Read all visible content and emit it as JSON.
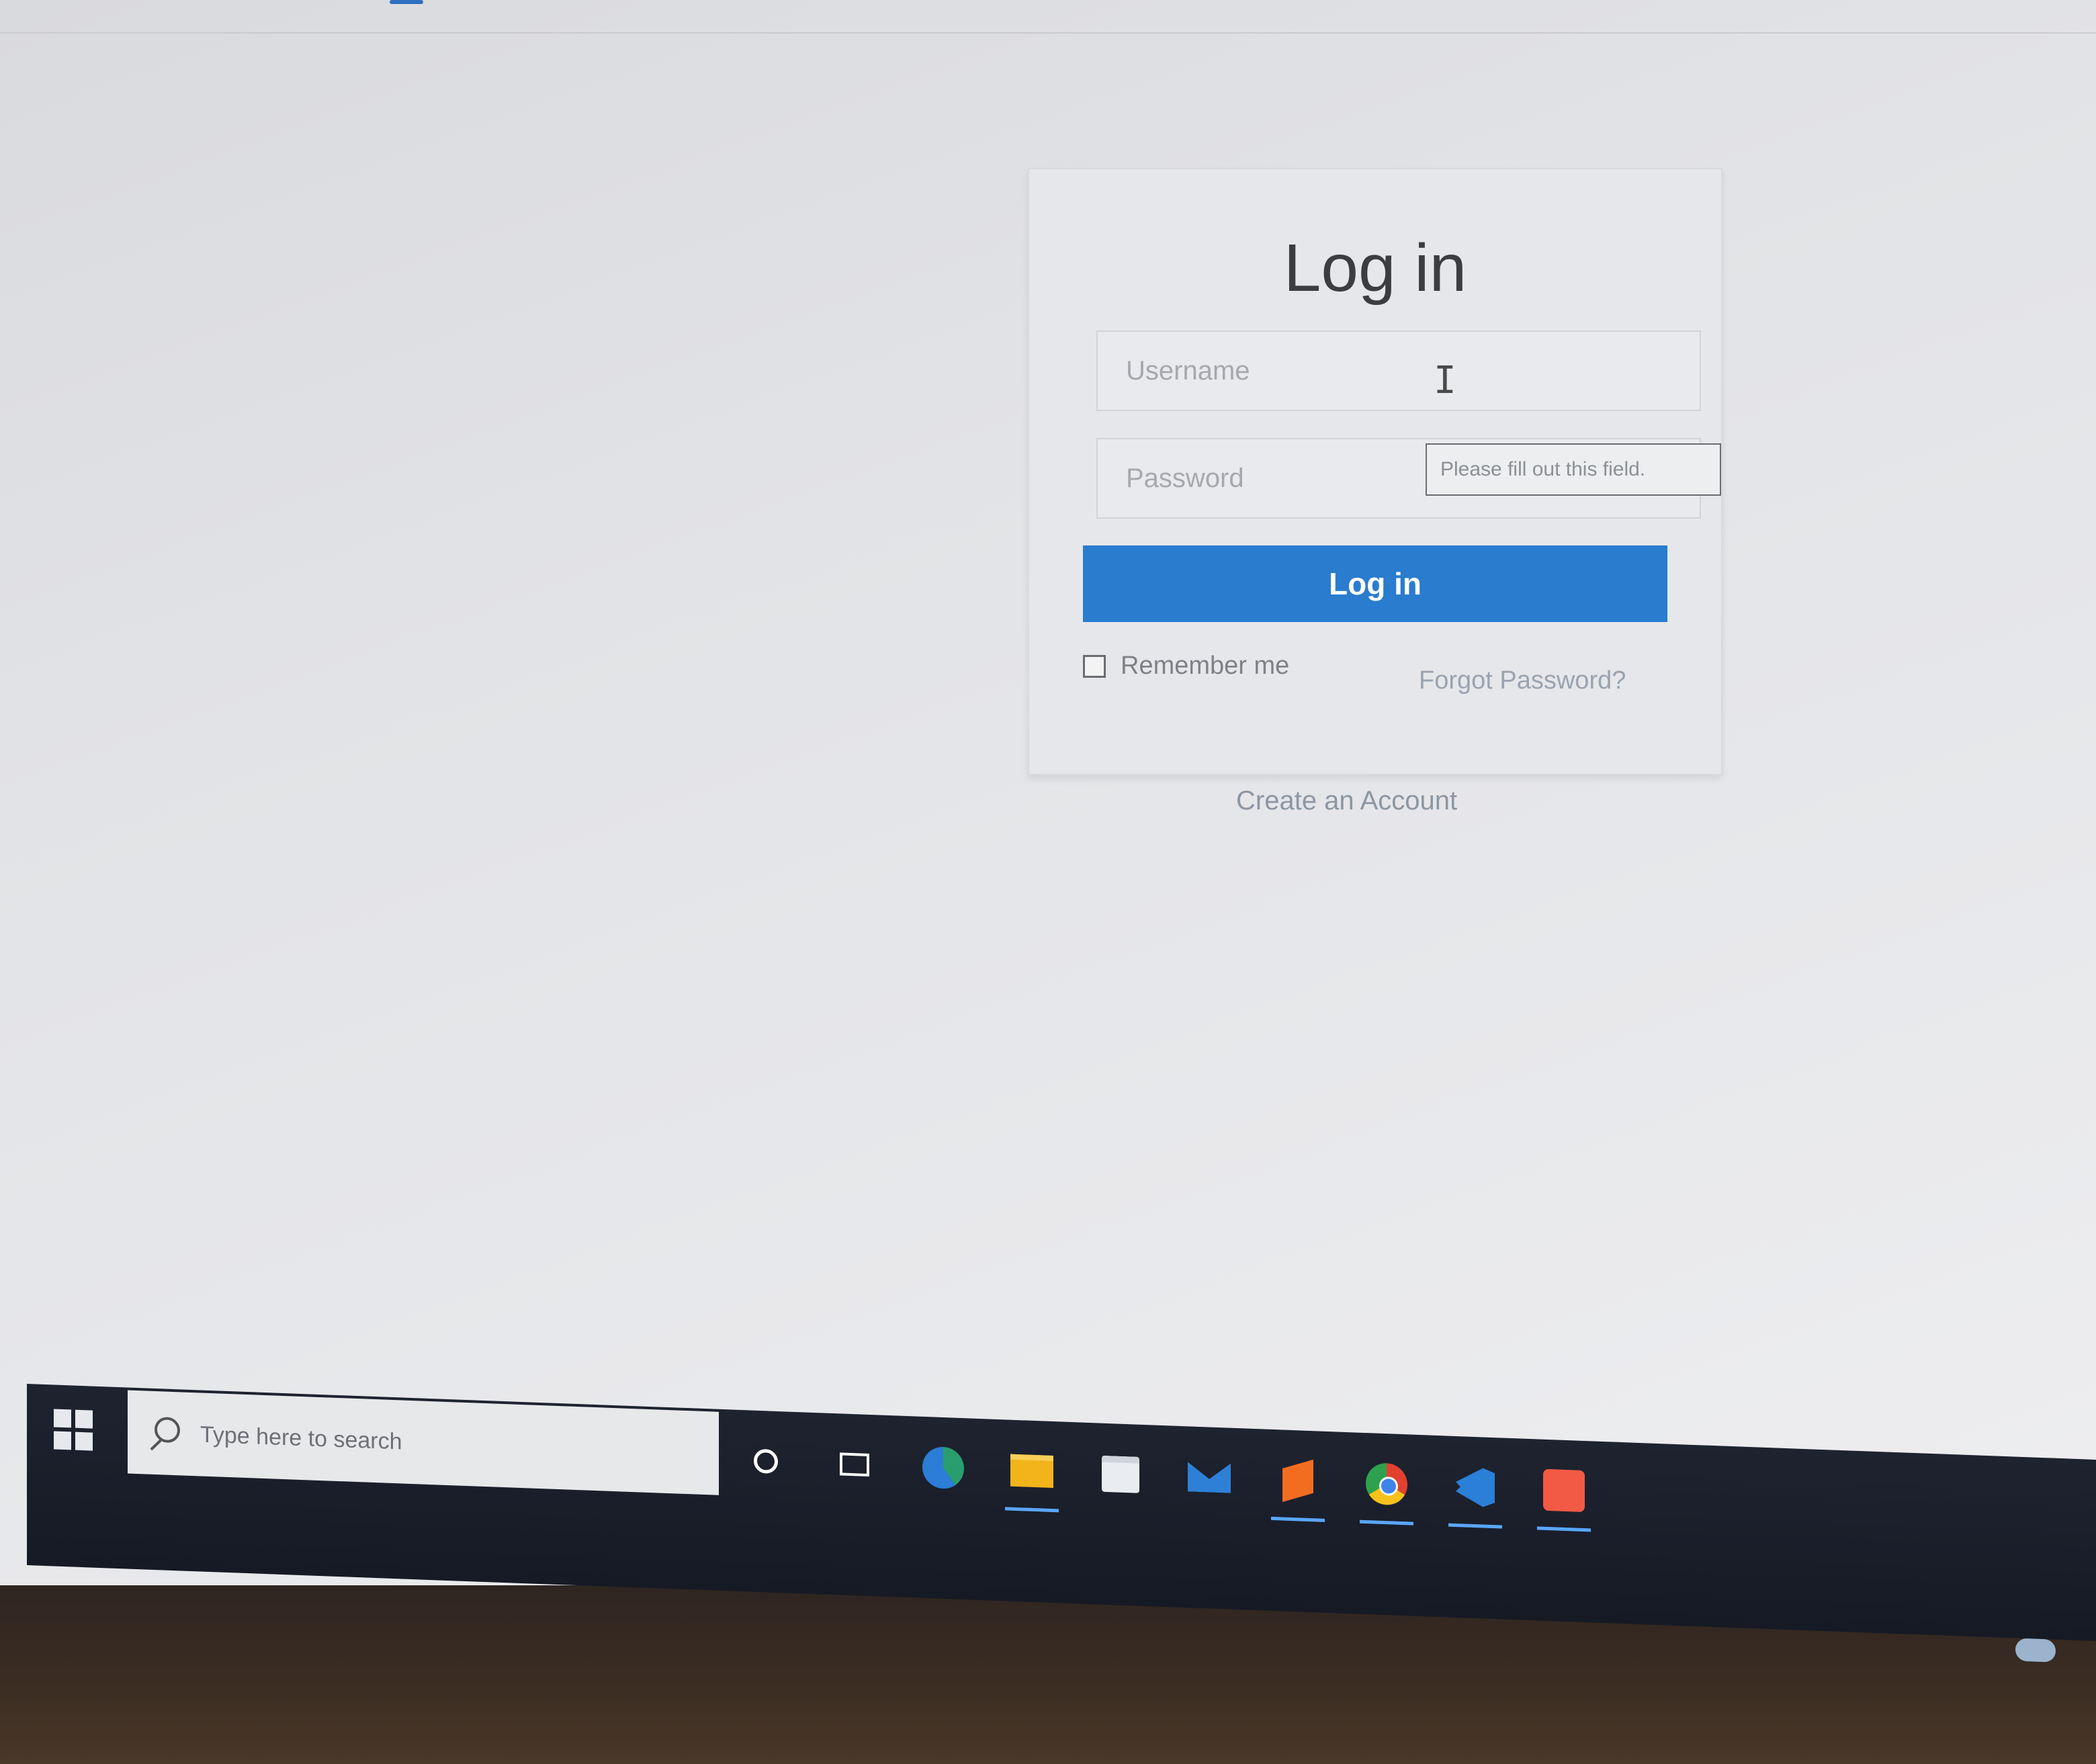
{
  "login": {
    "title": "Log in",
    "username_placeholder": "Username",
    "password_placeholder": "Password",
    "validation_tooltip": "Please fill out this field.",
    "login_button": "Log in",
    "remember_me": "Remember me",
    "forgot_password": "Forgot Password?",
    "create_account": "Create an Account"
  },
  "taskbar": {
    "search_placeholder": "Type here to search",
    "apps": [
      "cortana",
      "task-view",
      "edge",
      "file-explorer",
      "microsoft-store",
      "mail",
      "sublime-text",
      "chrome",
      "vs-code",
      "xampp"
    ]
  },
  "colors": {
    "login_button": "#2a7ccf",
    "taskbar": "#1e2330"
  }
}
